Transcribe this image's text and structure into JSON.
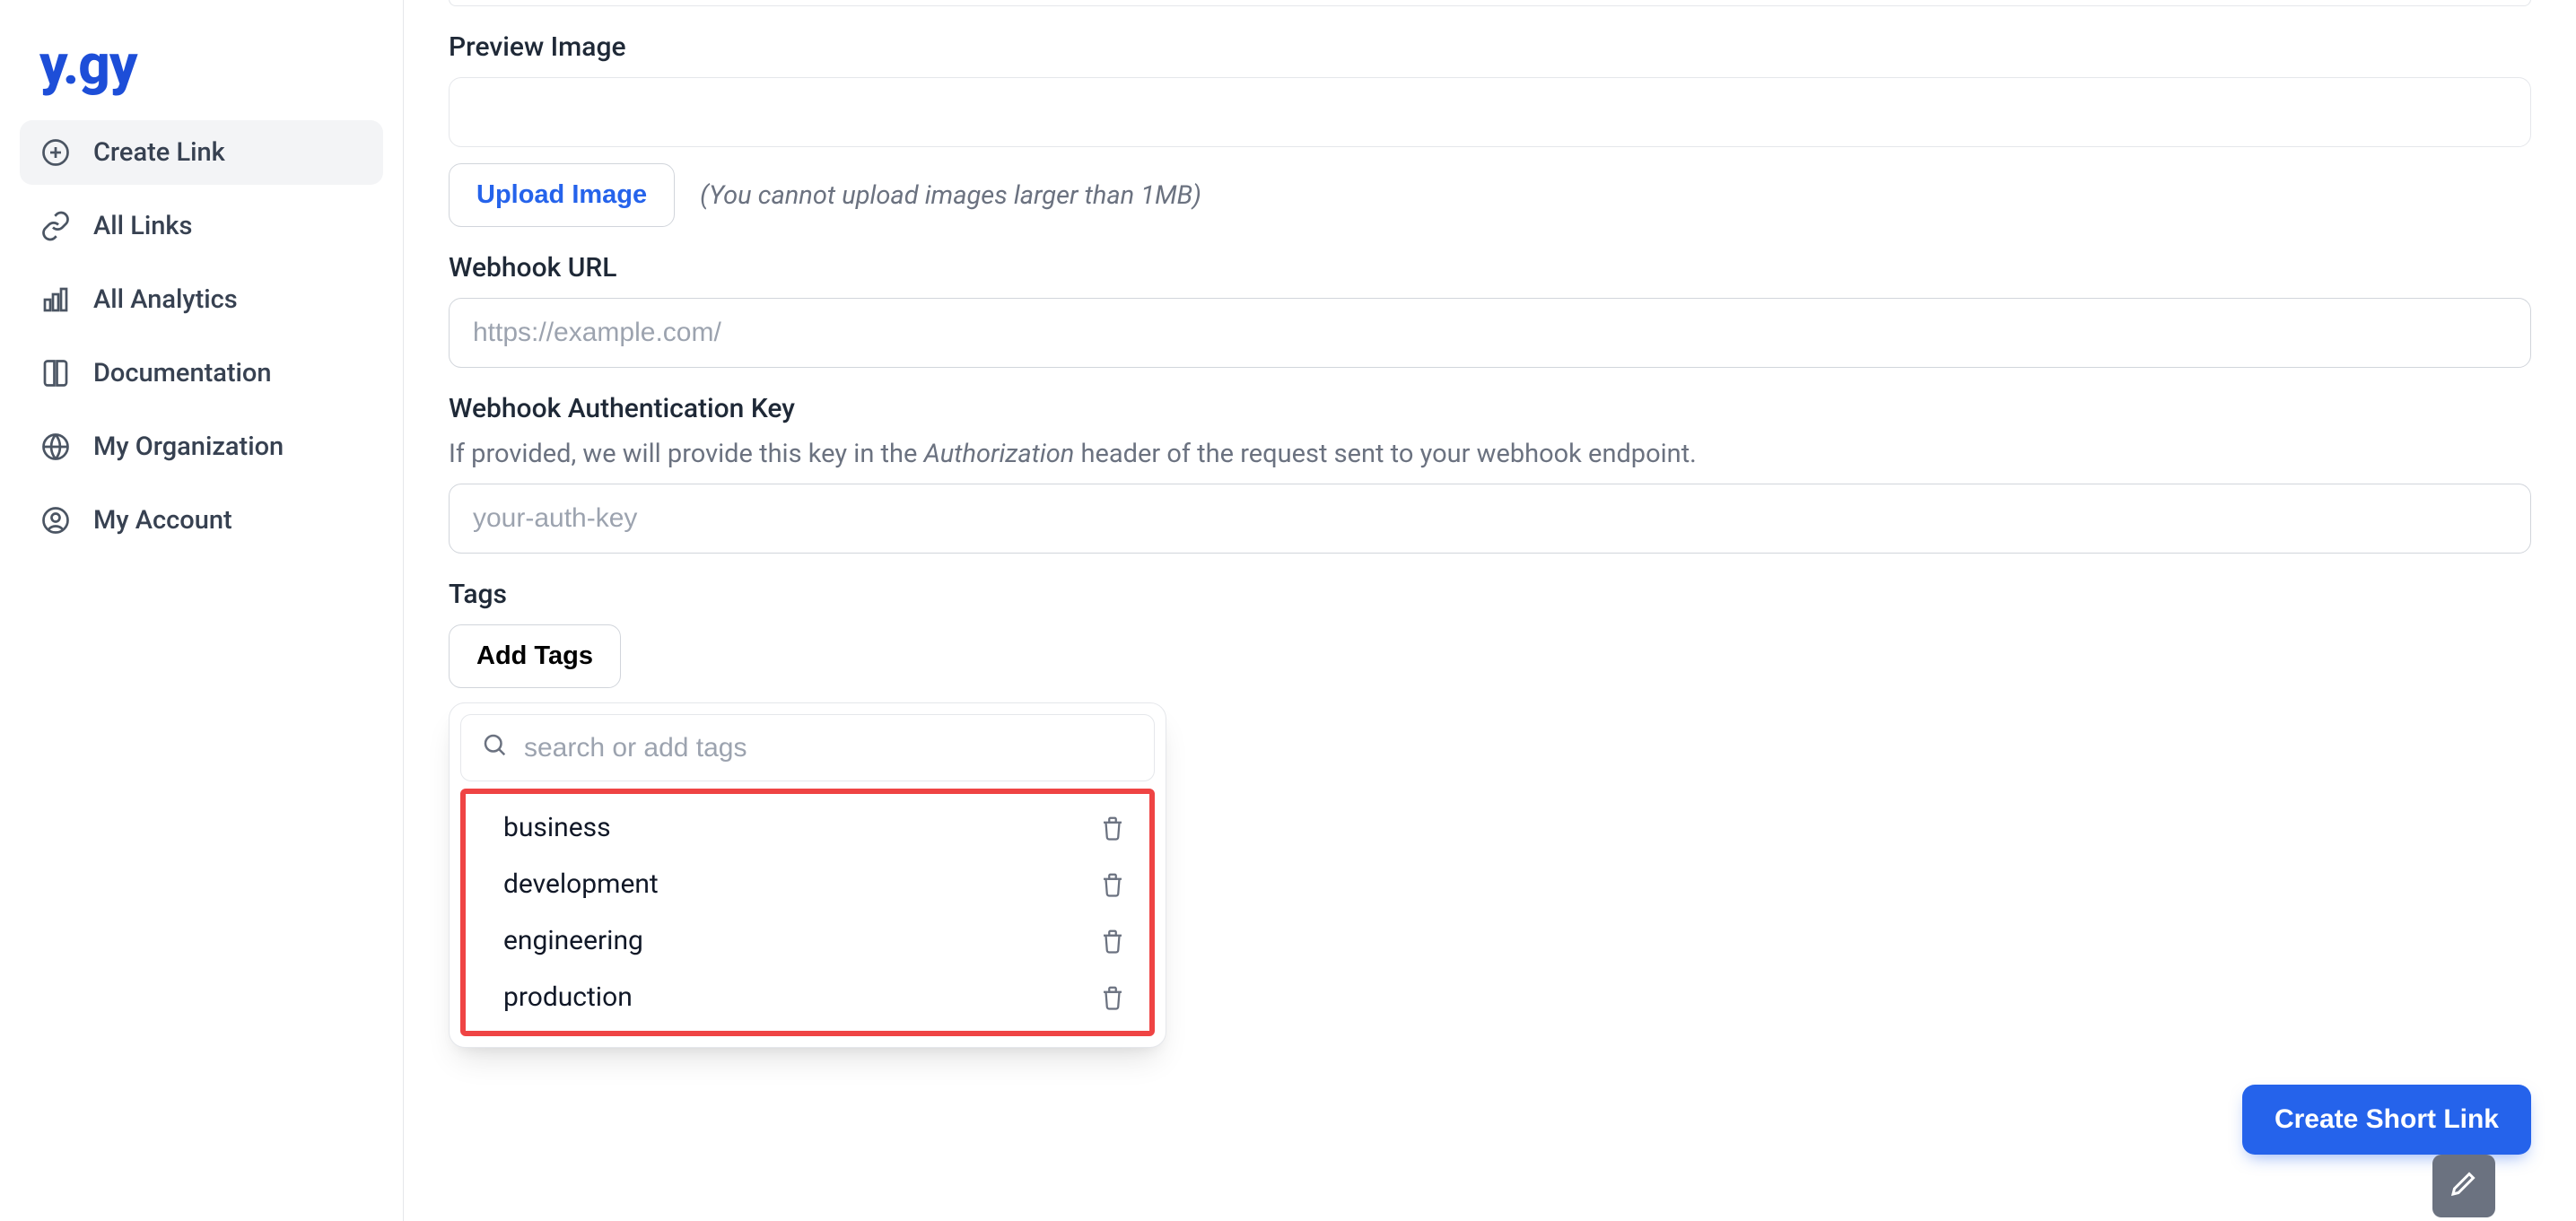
{
  "brand": {
    "logo_text": "y.gy"
  },
  "sidebar": {
    "items": [
      {
        "label": "Create Link"
      },
      {
        "label": "All Links"
      },
      {
        "label": "All Analytics"
      },
      {
        "label": "Documentation"
      },
      {
        "label": "My Organization"
      },
      {
        "label": "My Account"
      }
    ],
    "active_index": 0
  },
  "form": {
    "preview_image": {
      "label": "Preview Image",
      "upload_button": "Upload Image",
      "note": "(You cannot upload images larger than 1MB)"
    },
    "webhook_url": {
      "label": "Webhook URL",
      "placeholder": "https://example.com/",
      "value": ""
    },
    "webhook_auth": {
      "label": "Webhook Authentication Key",
      "helper_prefix": "If provided, we will provide this key in the ",
      "helper_em": "Authorization",
      "helper_suffix": " header of the request sent to your webhook endpoint.",
      "placeholder": "your-auth-key",
      "value": ""
    },
    "tags": {
      "label": "Tags",
      "add_button": "Add Tags",
      "search_placeholder": "search or add tags",
      "options": [
        {
          "name": "business"
        },
        {
          "name": "development"
        },
        {
          "name": "engineering"
        },
        {
          "name": "production"
        }
      ]
    }
  },
  "actions": {
    "create_short_link": "Create Short Link"
  },
  "colors": {
    "primary": "#2563eb",
    "highlight": "#ef4444"
  }
}
